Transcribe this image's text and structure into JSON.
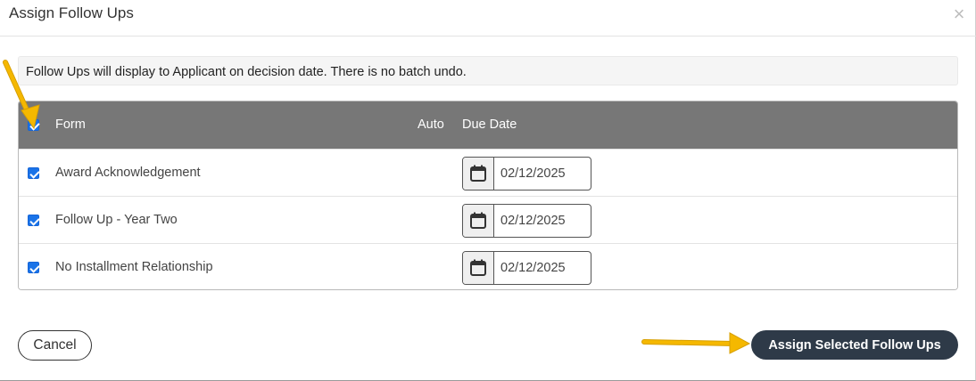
{
  "dialog": {
    "title": "Assign Follow Ups",
    "close_icon": "close-icon",
    "close_glyph": "×"
  },
  "notice": {
    "text": "Follow Ups will display to Applicant on decision date. There is no batch undo."
  },
  "table": {
    "headers": {
      "select_all_checked": true,
      "form": "Form",
      "auto": "Auto",
      "due_date": "Due Date"
    },
    "rows": [
      {
        "checked": true,
        "form": "Award Acknowledgement",
        "due_date": "02/12/2025",
        "calendar_icon": "calendar-icon"
      },
      {
        "checked": true,
        "form": "Follow Up - Year Two",
        "due_date": "02/12/2025",
        "calendar_icon": "calendar-icon"
      },
      {
        "checked": true,
        "form": "No Installment Relationship",
        "due_date": "02/12/2025",
        "calendar_icon": "calendar-icon"
      }
    ]
  },
  "footer": {
    "cancel_label": "Cancel",
    "assign_label": "Assign Selected Follow Ups"
  },
  "colors": {
    "header_bg": "#777777",
    "primary_button": "#2e3a48",
    "checkbox": "#1a73e8",
    "annotation_arrow": "#f5b800"
  }
}
